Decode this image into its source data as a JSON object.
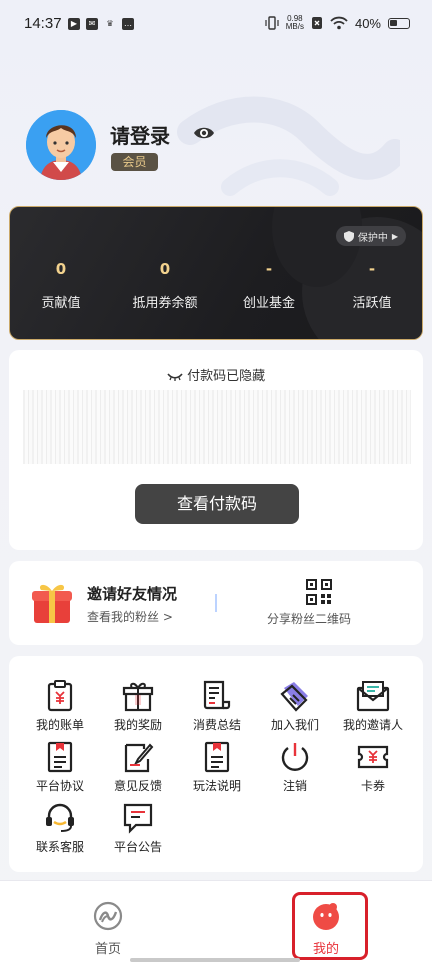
{
  "status_bar": {
    "time": "14:37",
    "speed_top": "0.98",
    "speed_bottom": "MB/s",
    "battery": "40%"
  },
  "profile": {
    "login": "请登录",
    "member_badge": "会员"
  },
  "account_card": {
    "protect_label": "保护中",
    "stats": [
      {
        "value": "0",
        "label": "贡献值"
      },
      {
        "value": "0",
        "label": "抵用券余额"
      },
      {
        "value": "-",
        "label": "创业基金"
      },
      {
        "value": "-",
        "label": "活跃值"
      }
    ]
  },
  "pay_code": {
    "title": "付款码已隐藏",
    "view_button": "查看付款码"
  },
  "invite": {
    "title": "邀请好友情况",
    "subtitle": "查看我的粉丝 >",
    "share_label": "分享粉丝二维码"
  },
  "menu_items": [
    {
      "label": "我的账单",
      "icon": "bill-icon"
    },
    {
      "label": "我的奖励",
      "icon": "gift-box-icon"
    },
    {
      "label": "消费总结",
      "icon": "receipt-icon"
    },
    {
      "label": "加入我们",
      "icon": "handshake-icon"
    },
    {
      "label": "我的邀请人",
      "icon": "mail-icon"
    },
    {
      "label": "平台协议",
      "icon": "agreement-icon"
    },
    {
      "label": "意见反馈",
      "icon": "feedback-icon"
    },
    {
      "label": "玩法说明",
      "icon": "instructions-icon"
    },
    {
      "label": "注销",
      "icon": "power-icon"
    },
    {
      "label": "卡券",
      "icon": "coupon-icon"
    },
    {
      "label": "联系客服",
      "icon": "headset-icon"
    },
    {
      "label": "平台公告",
      "icon": "announcement-icon"
    }
  ],
  "bottom_nav": {
    "home": "首页",
    "me": "我的"
  },
  "colors": {
    "accent_gold": "#f2d28e",
    "me_active": "#e8333a",
    "highlight_box": "#d8202a"
  }
}
